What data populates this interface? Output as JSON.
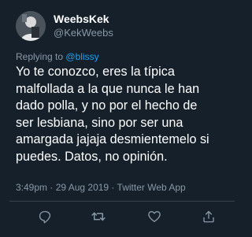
{
  "user": {
    "display_name": "WeebsKek",
    "handle": "@KekWeebs"
  },
  "reply": {
    "prefix": "Replying to",
    "mention": "@blissy"
  },
  "tweet": {
    "lines": [
      "Yo te conozco, eres la típica",
      "malfollada a la que nunca le han",
      "dado polla, y no por el hecho de",
      "ser lesbiana, sino por ser una",
      "amargada jajaja desmientemelo si",
      "puedes. Datos, no opinión."
    ],
    "meta": "3:49pm · 29 Aug 2019 · Twitter Web App"
  },
  "actions": {
    "icons": [
      "reply-icon",
      "retweet-icon",
      "like-icon",
      "share-icon"
    ]
  },
  "colors": {
    "background": "#15202b",
    "text": "#ffffff",
    "secondary": "#8899a6",
    "link": "#1da1f2",
    "divider": "#38444d"
  }
}
